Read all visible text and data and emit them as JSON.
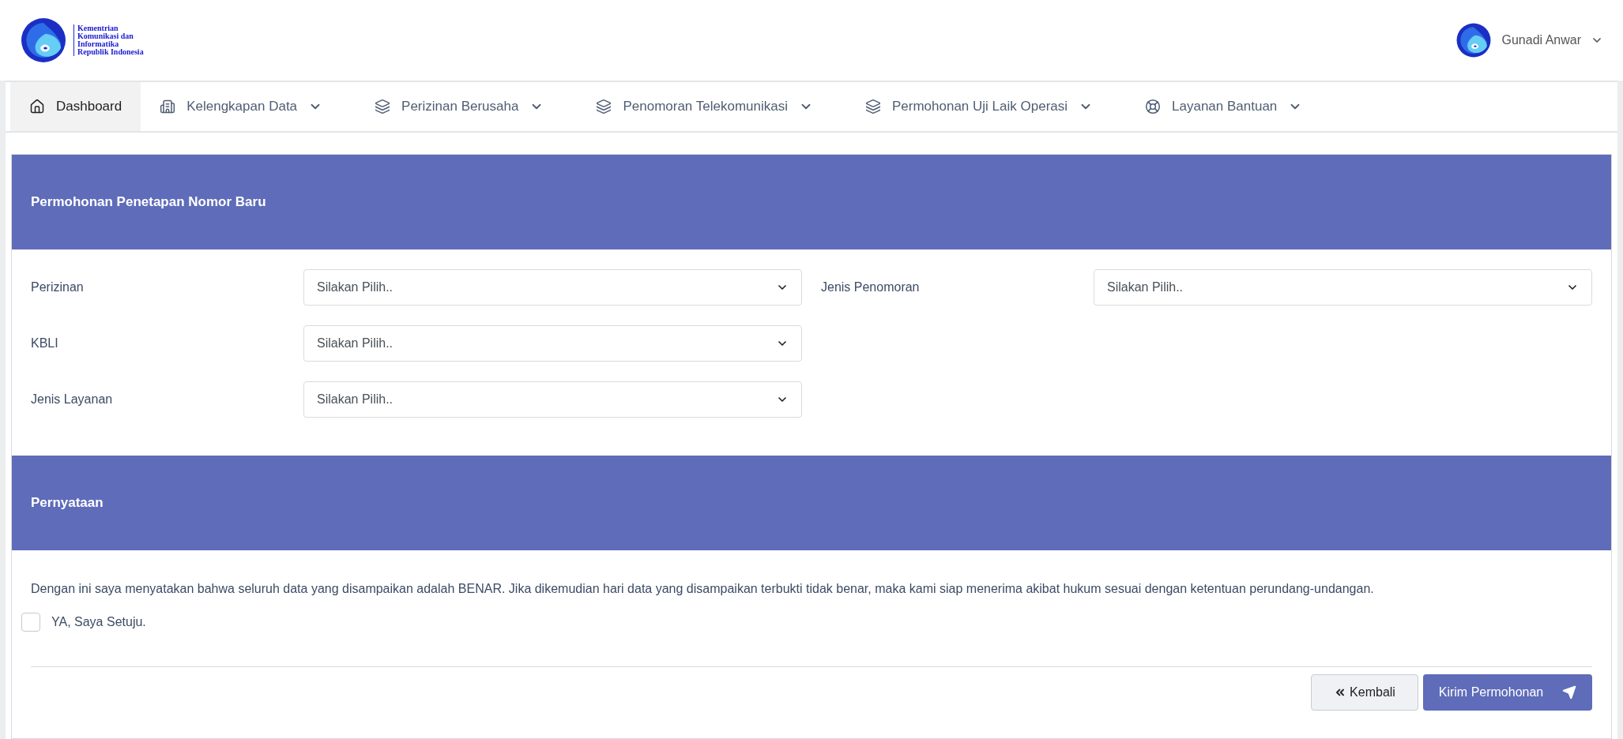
{
  "header": {
    "logo_text": [
      "Kementrian",
      "Komunikasi dan",
      "Informatika",
      "Republik Indonesia"
    ],
    "user": {
      "name": "Gunadi Anwar"
    }
  },
  "nav": [
    {
      "label": "Dashboard",
      "kind": "home",
      "dropdown": false,
      "selected": true
    },
    {
      "label": "Kelengkapan Data",
      "kind": "building",
      "dropdown": true,
      "selected": false
    },
    {
      "label": "Perizinan Berusaha",
      "kind": "layers",
      "dropdown": true,
      "selected": false
    },
    {
      "label": "Penomoran Telekomunikasi",
      "kind": "layers",
      "dropdown": true,
      "selected": false
    },
    {
      "label": "Permohonan Uji Laik Operasi",
      "kind": "layers",
      "dropdown": true,
      "selected": false
    },
    {
      "label": "Layanan Bantuan",
      "kind": "lifebuoy",
      "dropdown": true,
      "selected": false
    }
  ],
  "form_section": {
    "title": "Permohonan Penetapan Nomor Baru",
    "left_fields": [
      {
        "label": "Perizinan",
        "value": "Silakan Pilih.."
      },
      {
        "label": "KBLI",
        "value": "Silakan Pilih.."
      },
      {
        "label": "Jenis Layanan",
        "value": "Silakan Pilih.."
      }
    ],
    "right_fields": [
      {
        "label": "Jenis Penomoran",
        "value": "Silakan Pilih.."
      }
    ]
  },
  "statement_section": {
    "title": "Pernyataan",
    "text": "Dengan ini saya menyatakan bahwa seluruh data yang disampaikan adalah BENAR. Jika dikemudian hari data yang disampaikan terbukti tidak benar, maka kami siap menerima akibat hukum sesuai dengan ketentuan perundang-undangan.",
    "agree": {
      "label": "YA, Saya Setuju.",
      "checked": false
    }
  },
  "buttons": [
    {
      "label": "Kembali",
      "kind": "back"
    },
    {
      "label": "Kirim Permohonan",
      "kind": "submit"
    }
  ]
}
